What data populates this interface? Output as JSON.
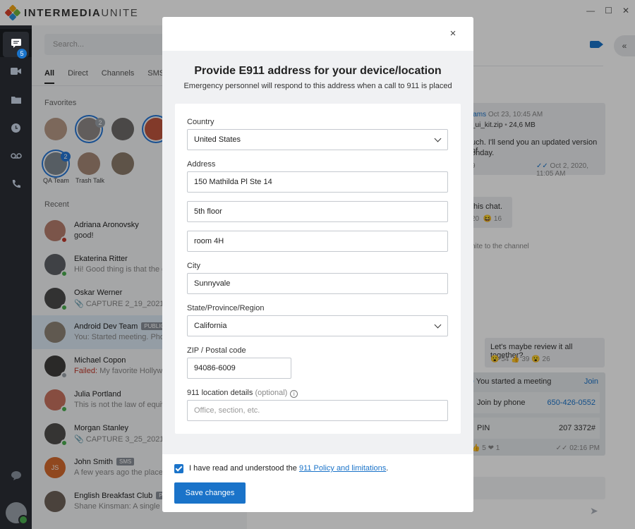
{
  "app": {
    "brand_bold": "INTERMEDIA",
    "brand_light": "UNITE",
    "window_controls": [
      "—",
      "☐",
      "✕"
    ]
  },
  "rail": {
    "chat_badge": "5",
    "icons": [
      "chat-icon",
      "video-icon",
      "folder-icon",
      "clock-icon",
      "voicemail-icon",
      "phone-icon"
    ]
  },
  "sidebar": {
    "search_placeholder": "Search...",
    "tabs": [
      "All",
      "Direct",
      "Channels",
      "SMS"
    ],
    "favorites_label": "Favorites",
    "favorites": [
      {
        "label": "",
        "badge": ""
      },
      {
        "label": "",
        "badge": "2"
      },
      {
        "label": "",
        "badge": ""
      },
      {
        "label": "",
        "badge": ""
      },
      {
        "label": "QA Team",
        "badge": "2"
      },
      {
        "label": "Trash Talk",
        "badge": ""
      },
      {
        "label": "",
        "badge": ""
      }
    ],
    "recent_label": "Recent",
    "recent": [
      {
        "name": "Adriana Aronovsky",
        "tag": "",
        "sub": "good!",
        "failed": ""
      },
      {
        "name": "Ekaterina Ritter",
        "tag": "",
        "sub": "Hi! Good thing is that the go",
        "failed": ""
      },
      {
        "name": "Oskar Werner",
        "tag": "",
        "sub": "📎 CAPTURE 2_19_2021, 10",
        "failed": ""
      },
      {
        "name": "Android Dev Team",
        "tag": "PUBLIC",
        "sub": "You: Started meeting. Phon",
        "failed": ""
      },
      {
        "name": "Michael Copon",
        "tag": "",
        "sub": " My favorite Hollywo",
        "failed": "Failed:"
      },
      {
        "name": "Julia Portland",
        "tag": "",
        "sub": "This is not the law of equiva",
        "failed": ""
      },
      {
        "name": "Morgan Stanley",
        "tag": "",
        "sub": "📎 CAPTURE 3_25_2021, 11",
        "failed": ""
      },
      {
        "name": "John Smith",
        "tag": "SMS",
        "sub": "A few years ago the place I",
        "failed": "",
        "initials": "JS"
      },
      {
        "name": "English Breakfast Club",
        "tag": "PU",
        "sub": "Shane Kinsman: A single so",
        "failed": ""
      }
    ]
  },
  "chat": {
    "msg1_author": "iams",
    "msg1_time": "Oct 23, 10:45 AM",
    "msg1_file": "_ui_kit.zip",
    "msg1_size": "24,6 MB",
    "msg1_text_a": "uch. I'll send you an updated version of",
    "msg1_text_b": "onday.",
    "msg1_count": "9",
    "msg1_stamp": "Oct 2, 2020, 11:05 AM",
    "msg2_text": "this chat.",
    "msg2_react_a": "20",
    "msg2_react_b": "16",
    "system_text": "hite to the channel",
    "msg3_text": "Let's maybe review it all together?",
    "msg3_react_a": "54",
    "msg3_react_b": "39",
    "msg3_react_c": "26",
    "meeting_title": "You started a meeting",
    "meeting_join": "Join",
    "join_by_phone": "Join by phone",
    "phone_number": "650-426-0552",
    "pin_label": "PIN",
    "pin_value": "207 3372#",
    "meeting_react_a": "5",
    "meeting_react_b": "1",
    "meeting_time": "02:16 PM"
  },
  "modal": {
    "title": "Provide E911 address for your device/location",
    "subtitle": "Emergency personnel will respond to this address when a call to 911 is placed",
    "country_label": "Country",
    "country_value": "United States",
    "address_label": "Address",
    "address_line1": "150 Mathilda Pl Ste 14",
    "address_line2": "5th floor",
    "address_line3": "room 4H",
    "city_label": "City",
    "city_value": "Sunnyvale",
    "state_label": "State/Province/Region",
    "state_value": "California",
    "zip_label": "ZIP / Postal code",
    "zip_value": "94086-6009",
    "details_label": "911 location details",
    "details_optional": "(optional)",
    "details_placeholder": "Office, section, etc.",
    "consent_prefix": "I have read and understood the ",
    "consent_link": "911 Policy and limitations",
    "consent_suffix": ".",
    "save_label": "Save changes",
    "close_glyph": "×"
  },
  "colors": {
    "accent": "#1a73c9",
    "rail": "#2b2f36",
    "online": "#4caf50",
    "failed": "#c0392b"
  }
}
